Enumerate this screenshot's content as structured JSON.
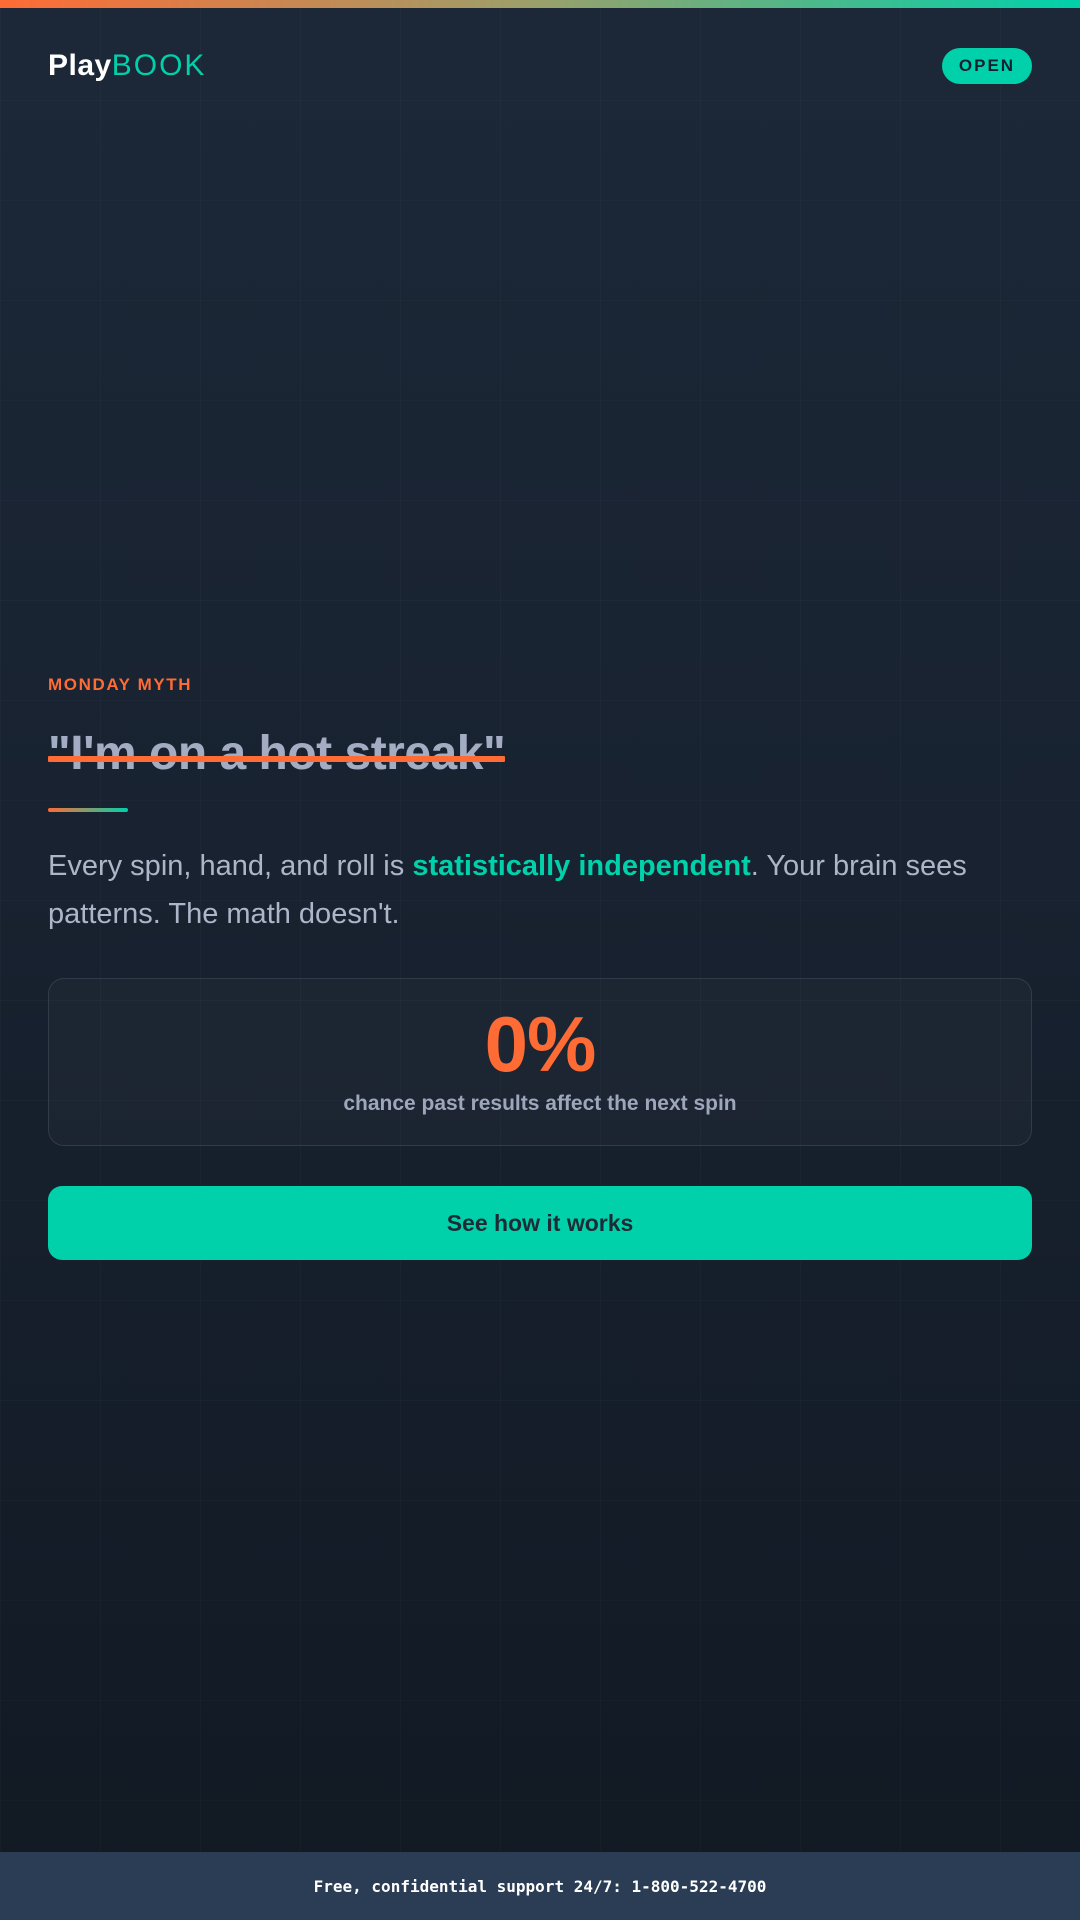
{
  "header": {
    "logo_part1": "Play",
    "logo_part2": "BOOK",
    "status_label": "OPEN"
  },
  "main": {
    "eyebrow": "MONDAY MYTH",
    "myth_quote": "\"I'm on a hot streak\"",
    "body_before": "Every spin, hand, and roll is ",
    "body_highlight": "statistically independent",
    "body_after": ". Your brain sees patterns. The math doesn't.",
    "stat": {
      "value": "0%",
      "label": "chance past results affect the next spin"
    },
    "cta_label": "See how it works"
  },
  "footer": {
    "support_text": "Free, confidential support 24/7: 1-800-522-4700"
  },
  "colors": {
    "accent_orange": "#ff6b35",
    "accent_teal": "#00d1aa",
    "background": "#1a2535",
    "footer_bg": "#2b3d54"
  }
}
